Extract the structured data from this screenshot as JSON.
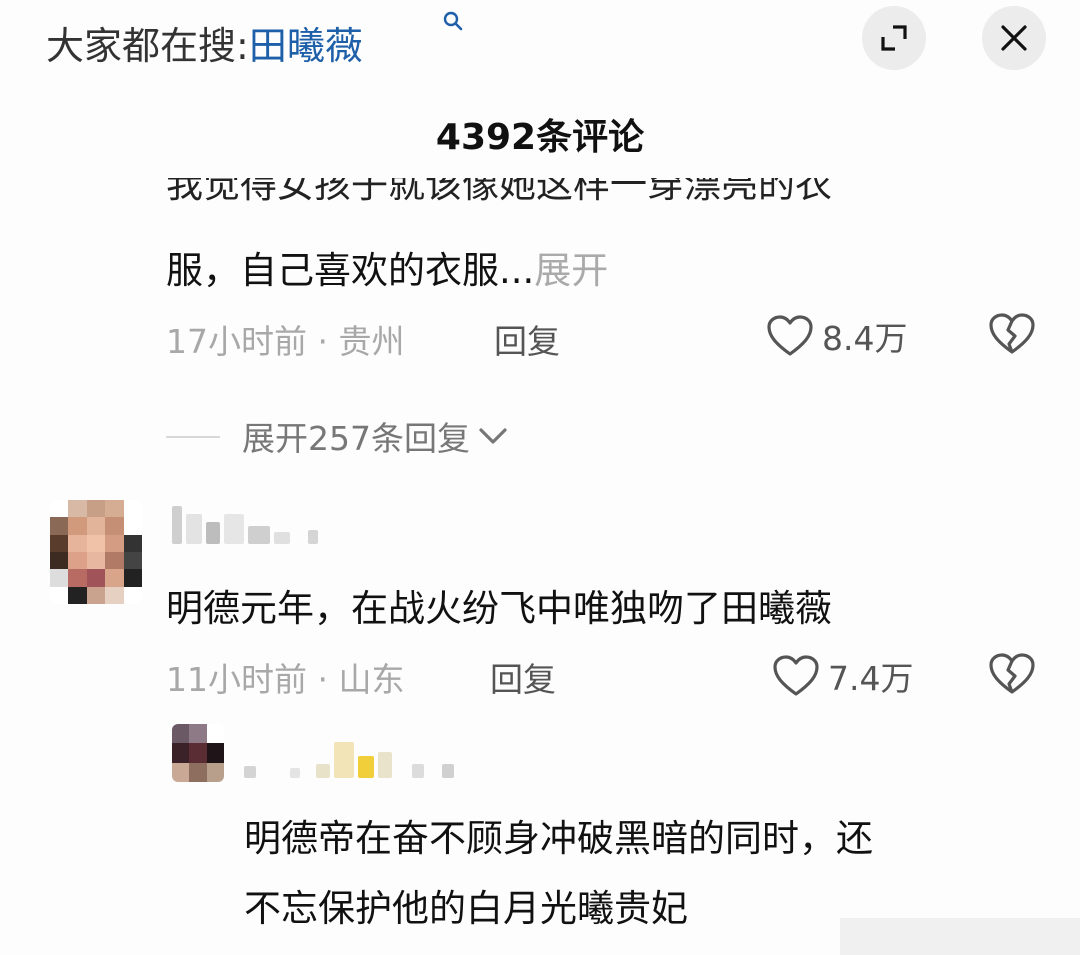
{
  "header": {
    "search_prefix": "大家都在搜:",
    "search_keyword": "田曦薇",
    "search_icon": "search-icon",
    "expand_icon": "expand-icon",
    "close_icon": "close-icon"
  },
  "comments_title": "4392条评论",
  "comments": [
    {
      "clipped_text": "我觉得女孩子就该像她这样一穿漂亮的衣",
      "text": "服，自己喜欢的衣服...",
      "more_label": "展开",
      "meta": "17小时前 · 贵州",
      "reply_label": "回复",
      "likes": "8.4万",
      "expand_replies_label": "展开257条回复"
    },
    {
      "text": "明德元年，在战火纷飞中唯独吻了田曦薇",
      "meta": "11小时前 · 山东",
      "reply_label": "回复",
      "likes": "7.4万"
    }
  ],
  "reply": {
    "text_line1": "明德帝在奋不顾身冲破黑暗的同时，还",
    "text_line2": "不忘保护他的白月光曦贵妃"
  },
  "colors": {
    "keyword_blue": "#1d5fa8",
    "meta_gray": "#a8a8a8",
    "background": "#fdfdfd"
  }
}
